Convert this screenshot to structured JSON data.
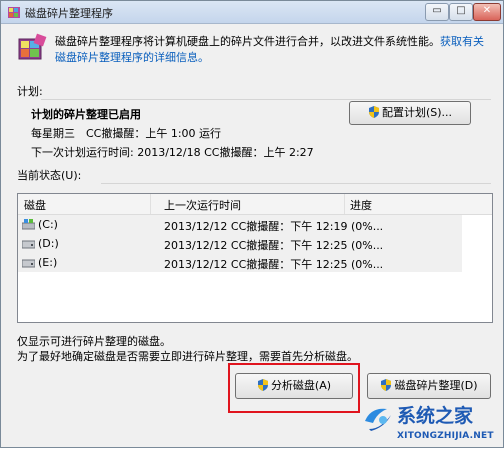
{
  "window": {
    "title": "磁盘碎片整理程序",
    "controls": {
      "minimize": "▭",
      "maximize": "□",
      "close": "✕"
    }
  },
  "intro": {
    "text": "磁盘碎片整理程序将计算机硬盘上的碎片文件进行合并，以改进文件系统性能。",
    "link": "获取有关磁盘碎片整理程序的详细信息。"
  },
  "schedule": {
    "label": "计划:",
    "enabled": "计划的碎片整理已启用",
    "run_time": "每星期三　CC撤撮醒：上午 1:00 运行",
    "next_run": "下一次计划运行时间: 2013/12/18 CC撤撮醒：上午 2:27",
    "config_button": "配置计划(S)..."
  },
  "status": {
    "label": "当前状态(U):",
    "columns": [
      "磁盘",
      "上一次运行时间",
      "进度"
    ],
    "rows": [
      {
        "disk": "(C:)",
        "last_run": "2013/12/12 CC撤撮醒：下午 12:19 (0%...",
        "progress": ""
      },
      {
        "disk": "(D:)",
        "last_run": "2013/12/12 CC撤撮醒：下午 12:25 (0%...",
        "progress": ""
      },
      {
        "disk": "(E:)",
        "last_run": "2013/12/12 CC撤撮醒：下午 12:25 (0%...",
        "progress": ""
      }
    ]
  },
  "footer": {
    "note1": "仅显示可进行碎片整理的磁盘。",
    "note2": "为了最好地确定磁盘是否需要立即进行碎片整理，需要首先分析磁盘。",
    "analyze_button": "分析磁盘(A)",
    "defrag_button": "磁盘碎片整理(D)"
  },
  "watermark": {
    "title": "系统之家",
    "url": "XITONGZHIJIA.NET"
  },
  "colors": {
    "link": "#0a5fbd",
    "highlight": "#e0141e",
    "watermark": "#1e5ab4"
  },
  "icons": [
    "defrag-app-icon",
    "shield-icon",
    "drive-icon"
  ]
}
